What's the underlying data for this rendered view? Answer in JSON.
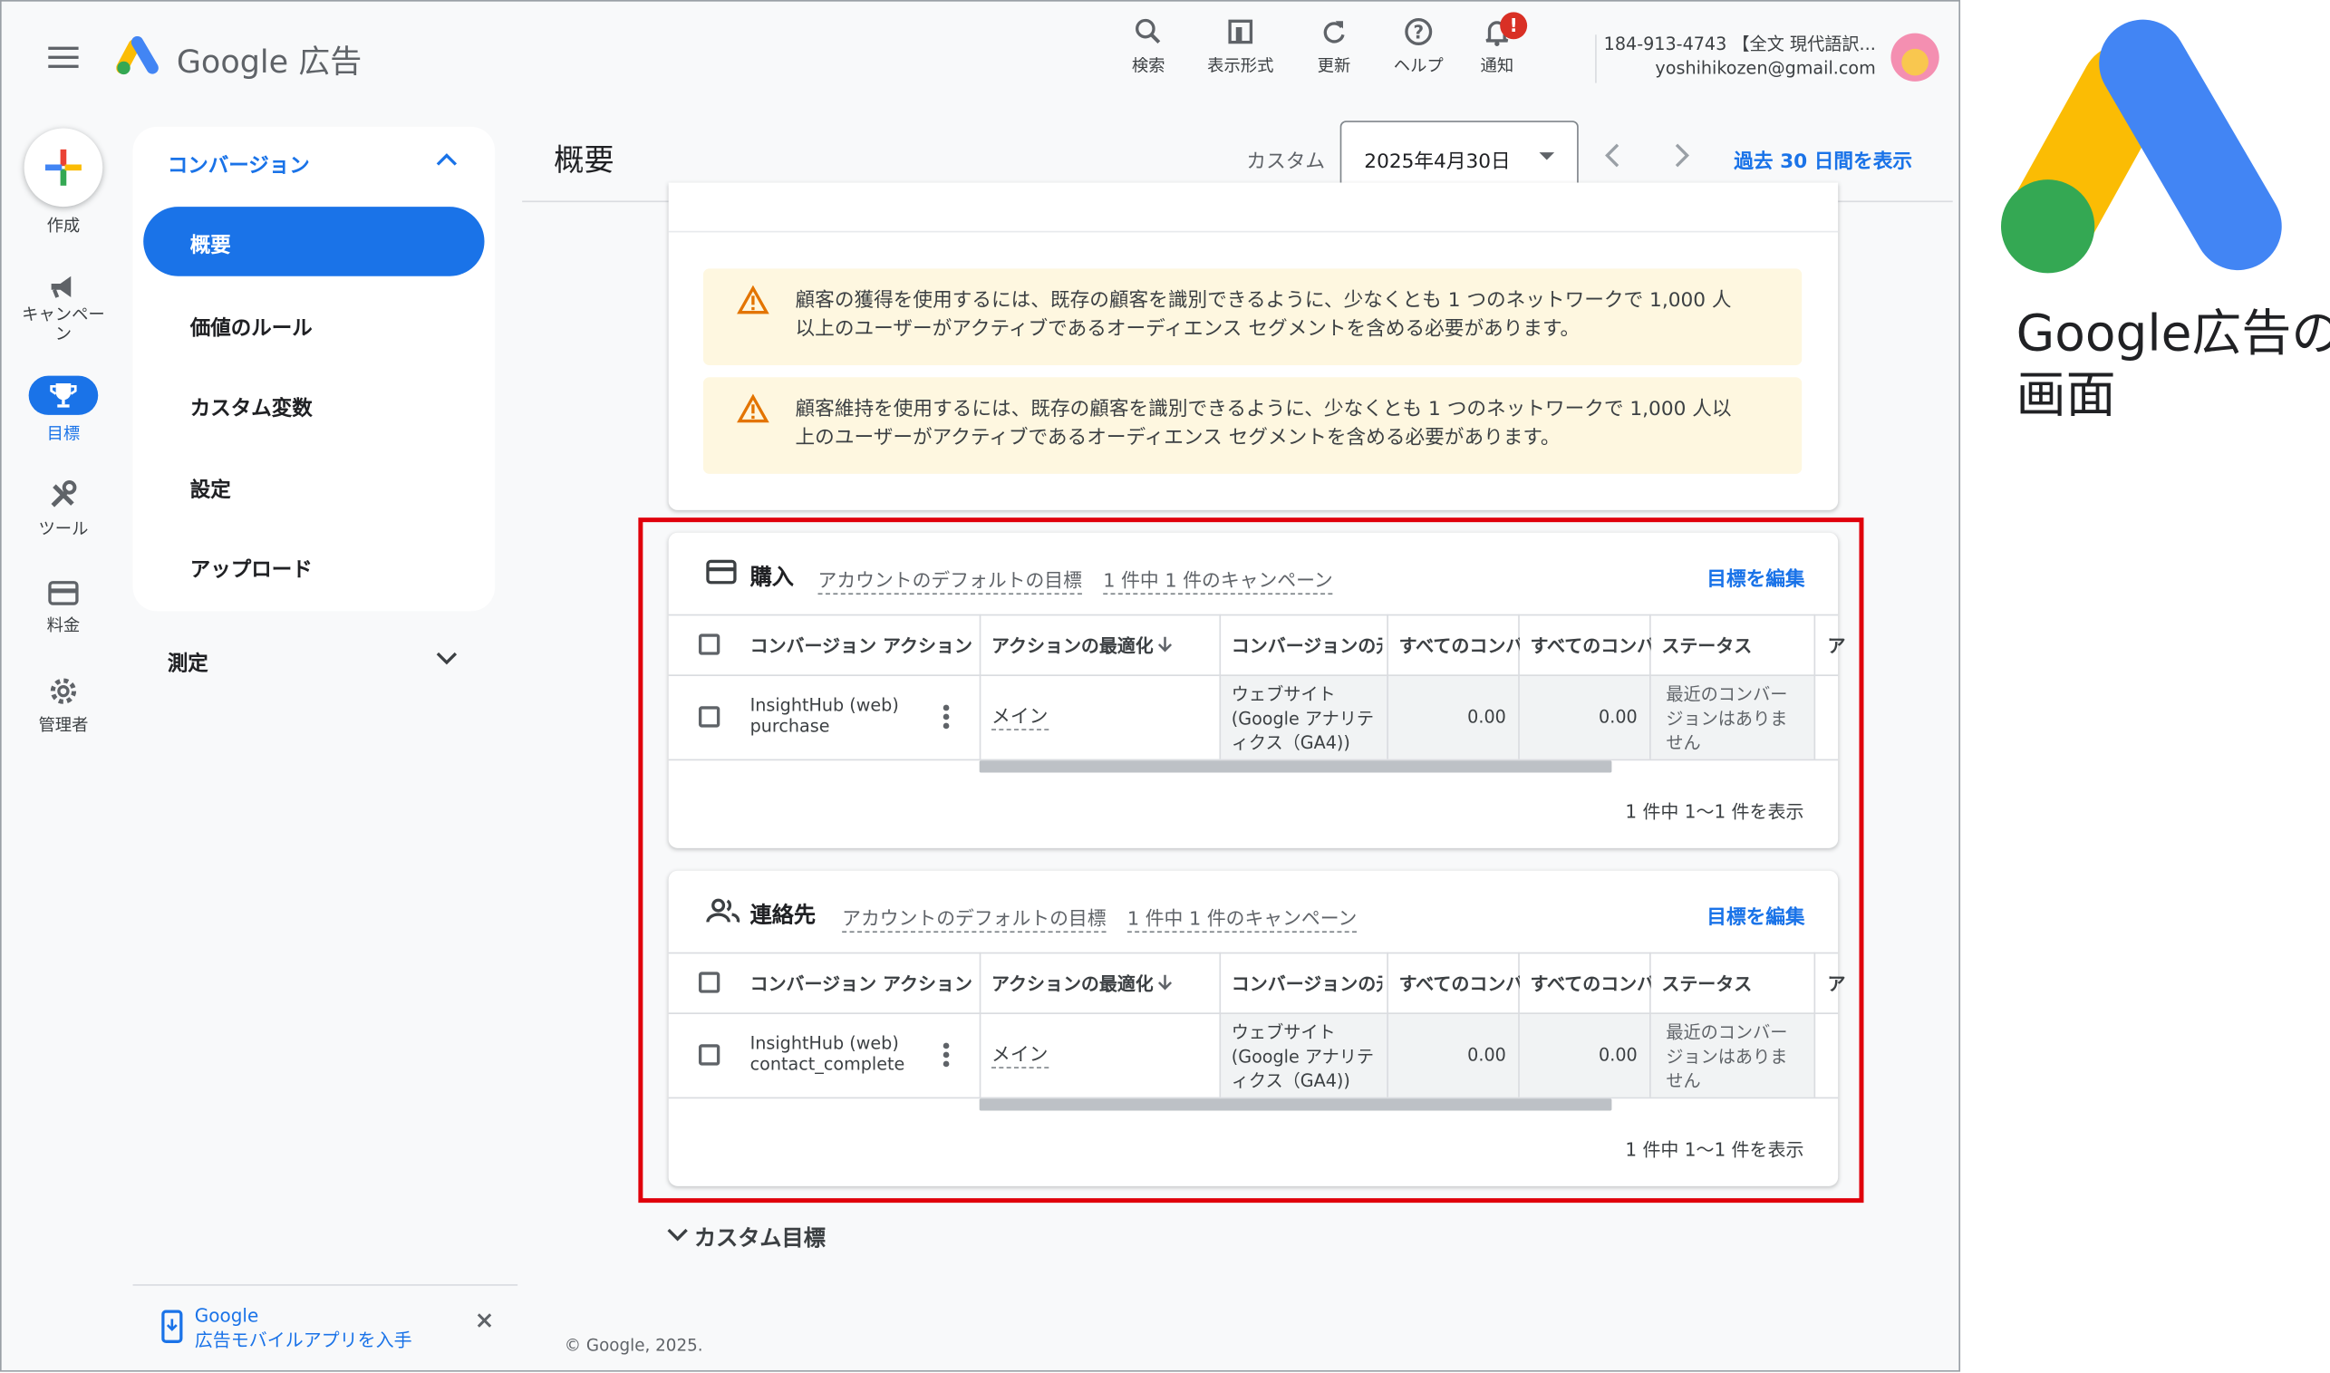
{
  "header": {
    "app_name": "Google 広告",
    "nav": [
      {
        "label": "検索",
        "icon": "search-icon"
      },
      {
        "label": "表示形式",
        "icon": "view-format-icon"
      },
      {
        "label": "更新",
        "icon": "refresh-icon"
      },
      {
        "label": "ヘルプ",
        "icon": "help-icon"
      },
      {
        "label": "通知",
        "icon": "bell-icon"
      }
    ],
    "notification_badge": "!",
    "account_id": "184-913-4743 【全文 現代語訳...",
    "account_email": "yoshihikozen@gmail.com"
  },
  "rail": {
    "create": "作成",
    "campaign": "キャンペーン",
    "goals": "目標",
    "tools": "ツール",
    "billing": "料金",
    "admin": "管理者"
  },
  "nav": {
    "section": "コンバージョン",
    "items": [
      "概要",
      "価値のルール",
      "カスタム変数",
      "設定",
      "アップロード"
    ],
    "measure": "測定"
  },
  "page": {
    "title": "概要",
    "date_mode": "カスタム",
    "date": "2025年4月30日",
    "show_30": "過去 30 日間を表示"
  },
  "warnings": [
    {
      "line1": "顧客の獲得を使用するには、既存の顧客を識別できるように、少なくとも 1 つのネットワークで 1,000 人",
      "line2": "以上のユーザーがアクティブであるオーディエンス セグメントを含める必要があります。"
    },
    {
      "line1": "顧客維持を使用するには、既存の顧客を識別できるように、少なくとも 1 つのネットワークで 1,000 人以",
      "line2": "上のユーザーがアクティブであるオーディエンス セグメントを含める必要があります。"
    }
  ],
  "goals": [
    {
      "title": "購入",
      "icon": "card-icon",
      "default": "アカウントのデフォルトの目標",
      "campaigns": "1 件中 1 件のキャンペーン",
      "edit": "目標を編集",
      "headers": [
        "コンバージョン アクション",
        "アクションの最適化",
        "コンバージョンの元",
        "すべてのコンバ",
        "すべてのコンバ",
        "ステータス"
      ],
      "row": {
        "action": "InsightHub (web) purchase",
        "opt": "メイン",
        "source": "ウェブサイト (Google アナリティクス（GA4))",
        "v1": "0.00",
        "v2": "0.00",
        "status": "最近のコンバージョンはありません"
      },
      "footer": "1 件中 1〜1 件を表示"
    },
    {
      "title": "連絡先",
      "icon": "people-icon",
      "default": "アカウントのデフォルトの目標",
      "campaigns": "1 件中 1 件のキャンペーン",
      "edit": "目標を編集",
      "headers": [
        "コンバージョン アクション",
        "アクションの最適化",
        "コンバージョンの元",
        "すべてのコンバ",
        "すべてのコンバ",
        "ステータス"
      ],
      "row": {
        "action": "InsightHub (web) contact_complete",
        "opt": "メイン",
        "source": "ウェブサイト (Google アナリティクス（GA4))",
        "v1": "0.00",
        "v2": "0.00",
        "status": "最近のコンバージョンはありません"
      },
      "footer": "1 件中 1〜1 件を表示"
    }
  ],
  "custom_goals": "カスタム目標",
  "promo": {
    "line1": "Google",
    "line2": "広告モバイルアプリを入手"
  },
  "copyright": "© Google, 2025.",
  "caption": {
    "line1": "Google広告の",
    "line2": "画面"
  },
  "colors": {
    "highlight": "#e0000b",
    "brand_blue": "#1a73e8",
    "warning_bg": "#fef7e0"
  }
}
